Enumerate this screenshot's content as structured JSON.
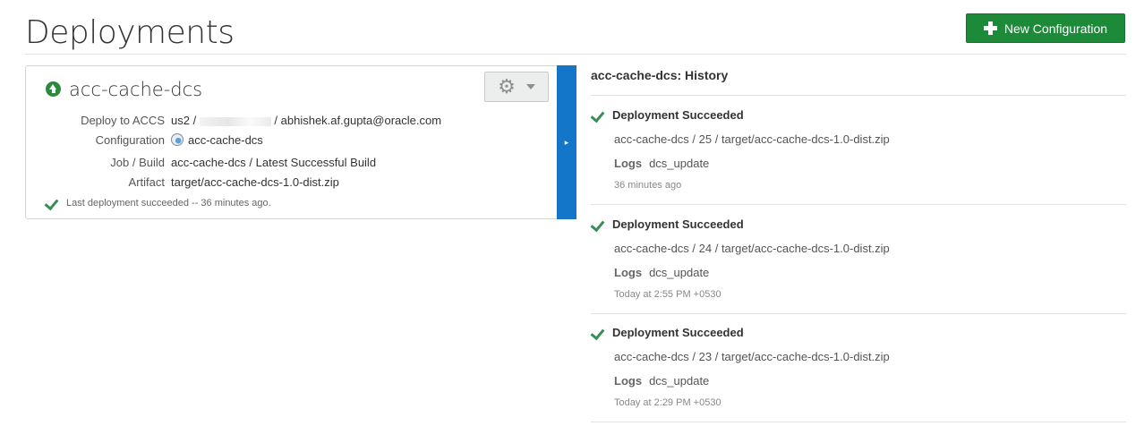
{
  "page": {
    "title": "Deployments"
  },
  "toolbar": {
    "new_config_label": "New Configuration"
  },
  "card": {
    "title": "acc-cache-dcs",
    "rows": [
      {
        "label": "Deploy to ACCS",
        "value_prefix": "us2 / ",
        "value_suffix": " / abhishek.af.gupta@oracle.com"
      },
      {
        "label": "Configuration",
        "value": "acc-cache-dcs"
      },
      {
        "label": "Job / Build",
        "value": "acc-cache-dcs / Latest Successful Build"
      },
      {
        "label": "Artifact",
        "value": "target/acc-cache-dcs-1.0-dist.zip"
      }
    ],
    "footer": "Last deployment succeeded -- 36 minutes ago."
  },
  "history": {
    "title": "acc-cache-dcs: History",
    "items": [
      {
        "status": "Deployment Succeeded",
        "path": "acc-cache-dcs / 25 / target/acc-cache-dcs-1.0-dist.zip",
        "logs_label": "Logs",
        "logs_value": "dcs_update",
        "time": "36 minutes ago"
      },
      {
        "status": "Deployment Succeeded",
        "path": "acc-cache-dcs / 24 / target/acc-cache-dcs-1.0-dist.zip",
        "logs_label": "Logs",
        "logs_value": "dcs_update",
        "time": "Today at 2:55 PM +0530"
      },
      {
        "status": "Deployment Succeeded",
        "path": "acc-cache-dcs / 23 / target/acc-cache-dcs-1.0-dist.zip",
        "logs_label": "Logs",
        "logs_value": "dcs_update",
        "time": "Today at 2:29 PM +0530"
      }
    ]
  },
  "colors": {
    "primary_button": "#1d8a3a",
    "collapse_bar": "#1476c8",
    "success": "#3a8d56"
  },
  "icons": {
    "new": "plus-icon",
    "status": "arrow-up-circle-icon",
    "settings": "gear-icon",
    "success": "checkmark-icon",
    "collapse": "chevron-right-icon"
  }
}
